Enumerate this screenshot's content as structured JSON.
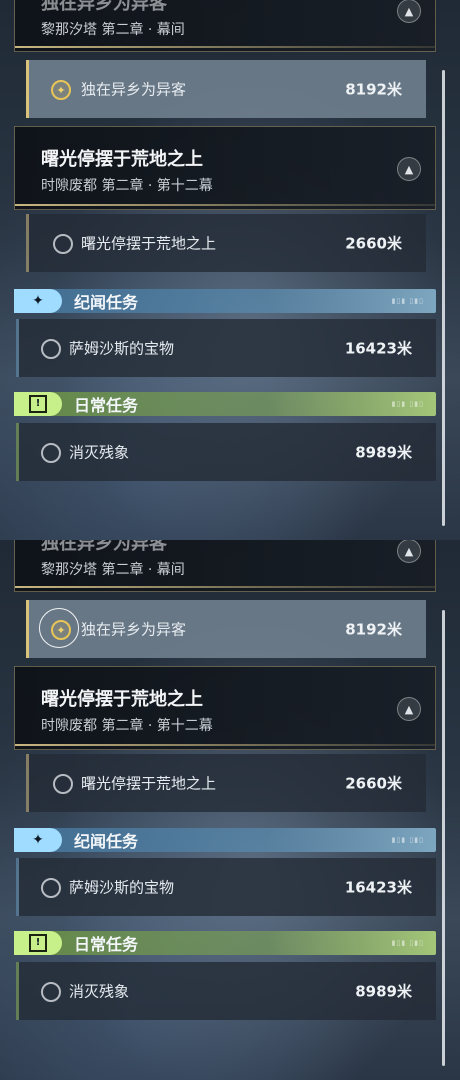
{
  "panels": [
    {
      "prev_chapter": {
        "title": "独在异乡为异客",
        "subtitle": "黎那汐塔 第二章 · 幕间"
      },
      "tracked_quest": {
        "name": "独在异乡为异客",
        "distance": "8192米"
      },
      "chapter": {
        "title": "曙光停摆于荒地之上",
        "subtitle": "时隙废都 第二章 · 第十二幕"
      },
      "chapter_quest": {
        "name": "曙光停摆于荒地之上",
        "distance": "2660米"
      },
      "side_category": {
        "label": "纪闻任务"
      },
      "side_quest": {
        "name": "萨姆沙斯的宝物",
        "distance": "16423米"
      },
      "daily_category": {
        "label": "日常任务"
      },
      "daily_quest": {
        "name": "消灭残象",
        "distance": "8989米"
      }
    },
    {
      "prev_chapter": {
        "title": "独在异乡为异客",
        "subtitle": "黎那汐塔 第二章 · 幕间"
      },
      "tracked_quest": {
        "name": "独在异乡为异客",
        "distance": "8192米"
      },
      "chapter": {
        "title": "曙光停摆于荒地之上",
        "subtitle": "时隙废都 第二章 · 第十二幕"
      },
      "chapter_quest": {
        "name": "曙光停摆于荒地之上",
        "distance": "2660米"
      },
      "side_category": {
        "label": "纪闻任务"
      },
      "side_quest": {
        "name": "萨姆沙斯的宝物",
        "distance": "16423米"
      },
      "daily_category": {
        "label": "日常任务"
      },
      "daily_quest": {
        "name": "消灭残象",
        "distance": "8989米"
      }
    }
  ],
  "icons": {
    "tracked": "star-compass-icon",
    "untracked": "circle-icon",
    "side_category": "sparkle-icon",
    "daily_category": "exclamation-box-icon",
    "chapter_badge": "arrow-up-icon"
  },
  "colors": {
    "tracked_accent": "#e9c557",
    "side_accent": "#9fdcff",
    "daily_accent": "#c8f08a"
  }
}
